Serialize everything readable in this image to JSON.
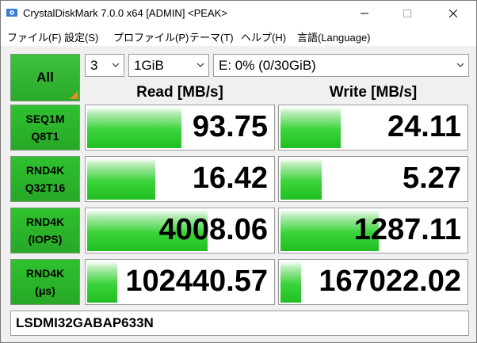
{
  "title": "CrystalDiskMark 7.0.0 x64 [ADMIN] <PEAK>",
  "menu": [
    "ファイル(F)",
    "設定(S)",
    "プロファイル(P)",
    "テーマ(T)",
    "ヘルプ(H)",
    "言語(Language)"
  ],
  "controls": {
    "all_label": "All",
    "count": "3",
    "size": "1GiB",
    "drive": "E: 0% (0/30GiB)"
  },
  "headers": {
    "read": "Read [MB/s]",
    "write": "Write [MB/s]"
  },
  "tests": [
    {
      "line1": "SEQ1M",
      "line2": "Q8T1",
      "read": "93.75",
      "write": "24.11",
      "read_fill": 0.5,
      "write_fill": 0.32
    },
    {
      "line1": "RND4K",
      "line2": "Q32T16",
      "read": "16.42",
      "write": "5.27",
      "read_fill": 0.36,
      "write_fill": 0.22
    },
    {
      "line1": "RND4K",
      "line2": "(IOPS)",
      "read": "4008.06",
      "write": "1287.11",
      "read_fill": 0.64,
      "write_fill": 0.52
    },
    {
      "line1": "RND4K",
      "line2": "(μs)",
      "read": "102440.57",
      "write": "167022.02",
      "read_fill": 0.16,
      "write_fill": 0.11
    }
  ],
  "comment": "LSDMI32GABAP633N",
  "colors": {
    "accent_green": "#27a827",
    "bar_green": "#20bf20",
    "corner_orange": "#f08a1a"
  }
}
